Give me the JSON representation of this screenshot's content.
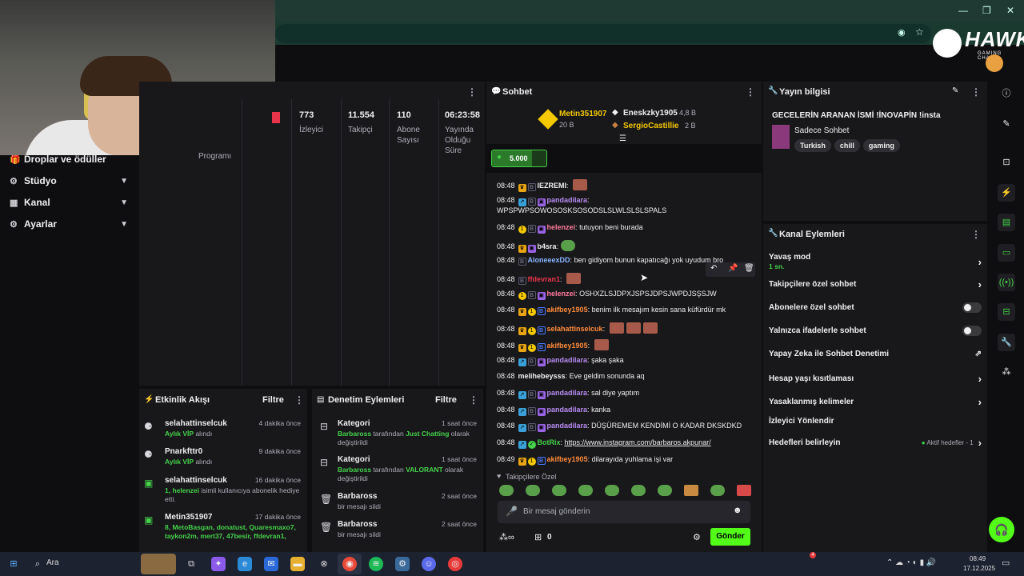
{
  "left_nav": [
    {
      "icon": "gift-icon",
      "label": "Droplar ve ödüller"
    },
    {
      "icon": "studio-icon",
      "label": "Stüdyo"
    },
    {
      "icon": "channel-icon",
      "label": "Kanal"
    },
    {
      "icon": "gear-icon",
      "label": "Ayarlar"
    }
  ],
  "stats": {
    "partial_label": "Programı",
    "items": [
      {
        "value": "773",
        "label": "İzleyici"
      },
      {
        "value": "11.554",
        "label": "Takipçi"
      },
      {
        "value": "110",
        "label": "Abone Sayısı"
      },
      {
        "value": "06:23:58",
        "label": "Yayında Olduğu Süre"
      }
    ]
  },
  "activity": {
    "title": "Etkinlik Akışı",
    "filter": "Filtre",
    "items": [
      {
        "name": "selahattinselcuk",
        "time": "4 dakika önce",
        "g": "Aylık VİP",
        "rest": " alındı"
      },
      {
        "name": "Pnarkfttr0",
        "time": "9 dakika önce",
        "g": "Aylık VİP",
        "rest": " alındı"
      },
      {
        "name": "selahattinselcuk",
        "time": "16 dakika önce",
        "g": "1, helenzei",
        "rest": " isimli kullanıcıya abonelik hediye etti."
      },
      {
        "name": "Metin351907",
        "time": "17 dakika önce",
        "g": "8, MetoBasgan, donatust, Quaresmaxo7, taykon2m, mert37, 47besir, ffdevran1,",
        "rest": ""
      }
    ]
  },
  "moderation": {
    "title": "Denetim Eylemleri",
    "filter": "Filtre",
    "items": [
      {
        "name": "Kategori",
        "time": "1 saat önce",
        "g1": "Barbaross",
        "mid": " tarafından ",
        "g2": "Just Chatting",
        "rest": " olarak değiştirildi"
      },
      {
        "name": "Kategori",
        "time": "1 saat önce",
        "g1": "Barbaross",
        "mid": " tarafından ",
        "g2": "VALORANT",
        "rest": " olarak değiştirildi"
      },
      {
        "name": "Barbaross",
        "time": "2 saat önce",
        "g1": "",
        "mid": "bir mesajı sildi",
        "g2": "",
        "rest": ""
      },
      {
        "name": "Barbaross",
        "time": "2 saat önce",
        "g1": "",
        "mid": "bir mesajı sildi",
        "g2": "",
        "rest": ""
      }
    ]
  },
  "chat": {
    "title": "Sohbet",
    "leaders": {
      "first": {
        "name": "Metin351907",
        "amount": "20 B"
      },
      "second": {
        "name": "Eneskzky1905",
        "amount": "4,8 B"
      },
      "third": {
        "name": "SergioCastillie",
        "amount": "2 B"
      }
    },
    "points": "5.000",
    "messages": [
      {
        "time": "08:48",
        "badges": [
          "mod",
          "b"
        ],
        "user": "IEZREMI",
        "color": "#efeff1",
        "text": "",
        "emotes": 1
      },
      {
        "time": "08:48",
        "badges": [
          "vip",
          "b",
          "sub"
        ],
        "user": "pandadilara",
        "color": "#b88cf0",
        "text": "WPSPWPSOWOSOSKSOSODSLSLWLSLSLSPALS",
        "emotes": 0
      },
      {
        "time": "08:48",
        "badges": [
          "gl",
          "b",
          "sub"
        ],
        "user": "helenzei",
        "color": "#ff7a9a",
        "text": "tutuyon beni burada",
        "emotes": 0
      },
      {
        "time": "08:48",
        "badges": [
          "mod",
          "sub"
        ],
        "user": "b4sra",
        "color": "#efeff1",
        "text": "",
        "emotes": 0,
        "green": 1
      },
      {
        "time": "08:48",
        "badges": [
          "b"
        ],
        "user": "AloneeexDD",
        "color": "#8ab4ff",
        "text": "ben gidiyom bunun kapatıcağı yok uyudum bro",
        "emotes": 0
      },
      {
        "time": "08:48",
        "badges": [
          "b"
        ],
        "user": "ffdevran1",
        "color": "#e8344a",
        "text": "",
        "emotes": 1
      },
      {
        "time": "08:48",
        "badges": [
          "gl",
          "b",
          "sub"
        ],
        "user": "helenzei",
        "color": "#ff7a9a",
        "text": "OSHXZLSJDPXJSPSJDPSJWPDJSŞSJW",
        "emotes": 0
      },
      {
        "time": "08:48",
        "badges": [
          "mod",
          "gl",
          "bb"
        ],
        "user": "akifbey1905",
        "color": "#ff8a3a",
        "text": "benim ilk mesajım kesin sana küfürdür mk",
        "emotes": 0
      },
      {
        "time": "08:48",
        "badges": [
          "mod",
          "gl",
          "bb"
        ],
        "user": "selahattinselcuk",
        "color": "#ff8a3a",
        "text": "",
        "emotes": 3
      },
      {
        "time": "08:48",
        "badges": [
          "mod",
          "gl",
          "bb"
        ],
        "user": "akifbey1905",
        "color": "#ff8a3a",
        "text": "",
        "emotes": 1
      },
      {
        "time": "08:48",
        "badges": [
          "vip",
          "b",
          "sub"
        ],
        "user": "pandadilara",
        "color": "#b88cf0",
        "text": "şaka şaka",
        "emotes": 0
      },
      {
        "time": "08:48",
        "badges": [],
        "user": "melihebeysss",
        "color": "#efeff1",
        "text": "Eve geldim sonunda aq",
        "emotes": 0
      },
      {
        "time": "08:48",
        "badges": [
          "vip",
          "b",
          "sub"
        ],
        "user": "pandadilara",
        "color": "#b88cf0",
        "text": "sal diye yaptım",
        "emotes": 0
      },
      {
        "time": "08:48",
        "badges": [
          "vip",
          "b",
          "sub"
        ],
        "user": "pandadilara",
        "color": "#b88cf0",
        "text": "kanka",
        "emotes": 0
      },
      {
        "time": "08:48",
        "badges": [
          "vip",
          "b",
          "sub"
        ],
        "user": "pandadilara",
        "color": "#b88cf0",
        "text": "DÜŞÜREMEM KENDİMİ O KADAR DKSKDKD",
        "emotes": 0
      },
      {
        "time": "08:48",
        "badges": [
          "vip",
          "bot"
        ],
        "user": "BotRix",
        "color": "#45d14a",
        "text": "https://www.instagram.com/barbaros.akpunar/",
        "emotes": 0
      },
      {
        "time": "08:49",
        "badges": [
          "mod",
          "gl",
          "bb"
        ],
        "user": "akifbey1905",
        "color": "#ff8a3a",
        "text": "dilarayıda yuhlama işi var",
        "emotes": 0
      }
    ],
    "followers_only_label": "Takipçilere Özel",
    "input_placeholder": "Bir mesaj gönderin",
    "count": "0",
    "send_label": "Gönder"
  },
  "stream_info": {
    "title": "Yayın bilgisi",
    "stream_title": "GECELERİN ARANAN İSMİ !İNOVAPİN !insta",
    "category": "Sadece Sohbet",
    "tags": [
      "Turkish",
      "chill",
      "gaming"
    ]
  },
  "channel_actions": {
    "title": "Kanal Eylemleri",
    "slow_mode": "Yavaş mod",
    "slow_value": "1 sn.",
    "followers_chat": "Takipçilere özel sohbet",
    "subs_chat": "Abonelere özel sohbet",
    "emote_chat": "Yalnızca ifadelerle sohbet",
    "ai_moderation": "Yapay Zeka ile Sohbet Denetimi",
    "age_restriction": "Hesap yaşı kısıtlaması",
    "banned_words": "Yasaklanmış kelimeler",
    "viewer_redirect": "İzleyici Yönlendir",
    "set_goals": "Hedefleri belirleyin",
    "active_goals": "Aktif hedefler - 1"
  },
  "taskbar": {
    "search": "Ara",
    "time": "08:49",
    "date": "17.12.2025",
    "badge": "4"
  },
  "logo": {
    "text": "HAWK",
    "sub": "GAMING CHAIR"
  }
}
